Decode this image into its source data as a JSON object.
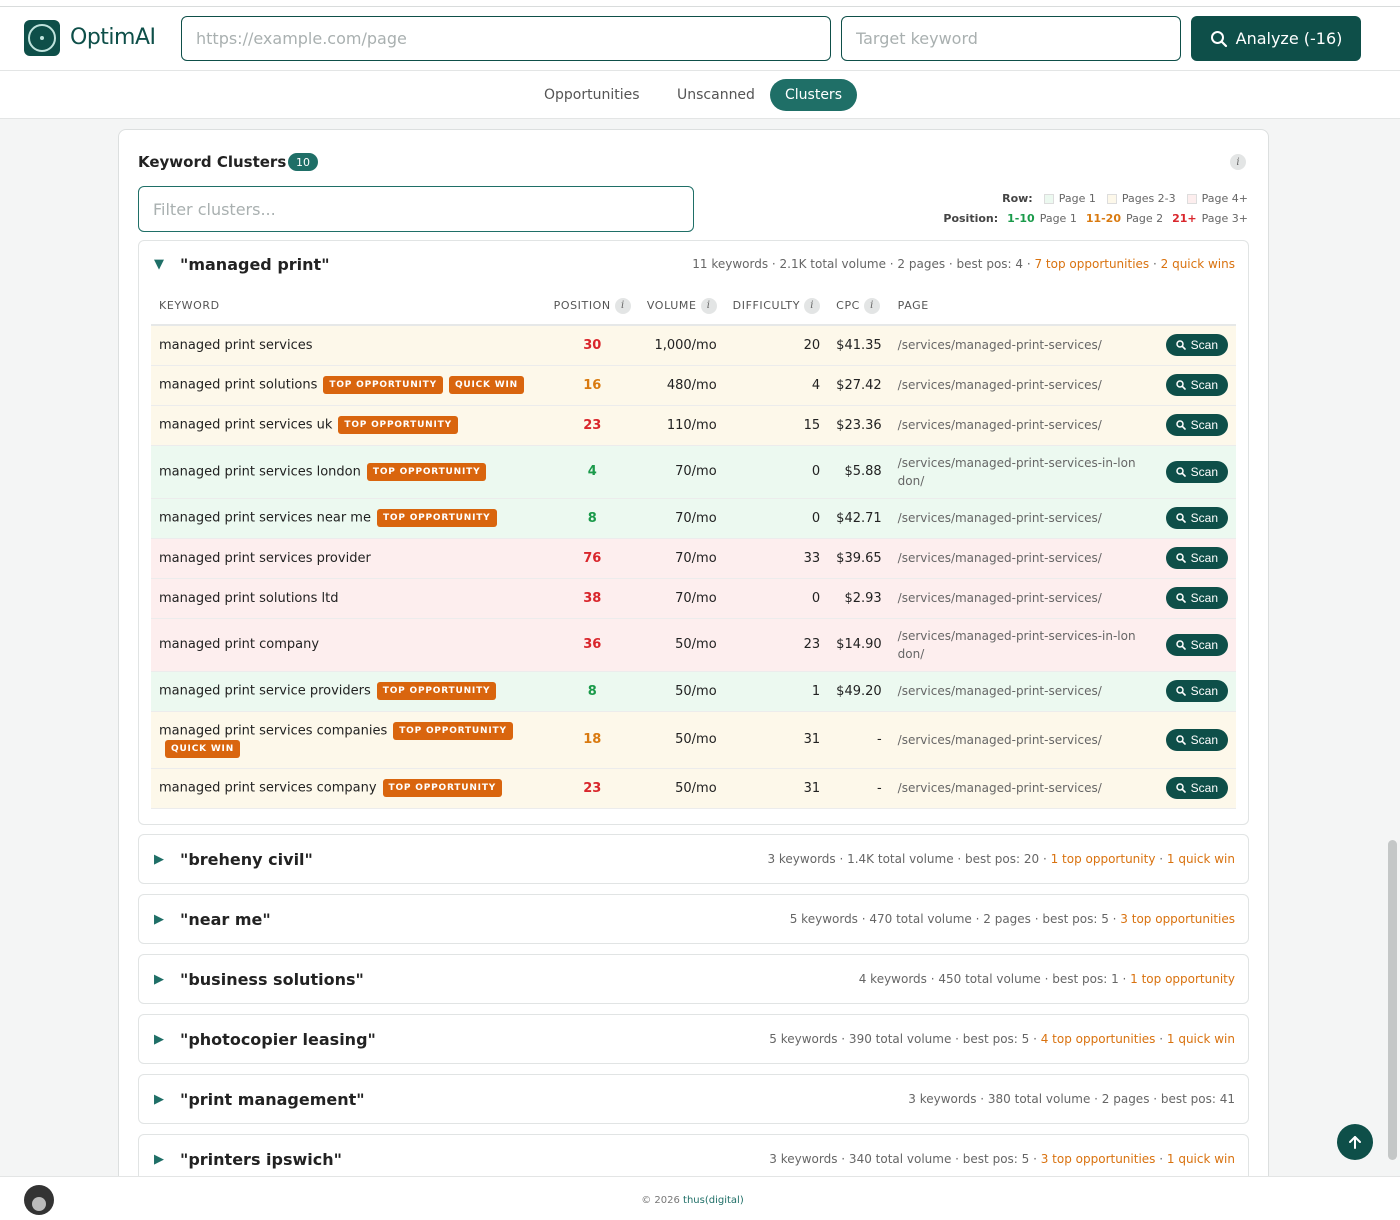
{
  "app": {
    "brand": "OptimAI"
  },
  "header": {
    "url_placeholder": "https://example.com/page",
    "keyword_placeholder": "Target keyword",
    "analyze_label": "Analyze (-16)"
  },
  "tabs": [
    {
      "label": "Opportunities",
      "active": false
    },
    {
      "label": "Unscanned",
      "active": false
    },
    {
      "label": "Clusters",
      "active": true
    }
  ],
  "card": {
    "title": "Keyword Clusters",
    "count": "10",
    "filter_placeholder": "Filter clusters...",
    "legend": {
      "row_label": "Row:",
      "row_items": [
        "Page 1",
        "Pages 2-3",
        "Page 4+"
      ],
      "row_colors": [
        "#ecf9f0",
        "#fdf8ea",
        "#fdeeee"
      ],
      "position_label": "Position:",
      "pos_items": [
        {
          "range": "1-10",
          "page": "Page 1"
        },
        {
          "range": "11-20",
          "page": "Page 2"
        },
        {
          "range": "21+",
          "page": "Page 3+"
        }
      ]
    }
  },
  "open_cluster": {
    "name": "\"managed print\"",
    "meta": "11 keywords · 2.1K total volume · 2 pages · best pos: 4 · ",
    "meta_hl1": "7 top opportunities",
    "meta_sep": " · ",
    "meta_hl2": "2 quick wins",
    "columns": [
      "KEYWORD",
      "POSITION",
      "VOLUME",
      "DIFFICULTY",
      "CPC",
      "PAGE"
    ],
    "scan_label": "Scan",
    "tag_top": "TOP OPPORTUNITY",
    "tag_quick": "QUICK WIN",
    "rows": [
      {
        "keyword": "managed print services",
        "position": "30",
        "volume": "1,000/mo",
        "difficulty": "20",
        "cpc": "$41.35",
        "page": "/services/managed-print-services/"
      },
      {
        "keyword": "managed print solutions",
        "position": "16",
        "volume": "480/mo",
        "difficulty": "4",
        "cpc": "$27.42",
        "page": "/services/managed-print-services/"
      },
      {
        "keyword": "managed print services uk",
        "position": "23",
        "volume": "110/mo",
        "difficulty": "15",
        "cpc": "$23.36",
        "page": "/services/managed-print-services/"
      },
      {
        "keyword": "managed print services london",
        "position": "4",
        "volume": "70/mo",
        "difficulty": "0",
        "cpc": "$5.88",
        "page": "/services/managed-print-services-in-london/"
      },
      {
        "keyword": "managed print services near me",
        "position": "8",
        "volume": "70/mo",
        "difficulty": "0",
        "cpc": "$42.71",
        "page": "/services/managed-print-services/"
      },
      {
        "keyword": "managed print services provider",
        "position": "76",
        "volume": "70/mo",
        "difficulty": "33",
        "cpc": "$39.65",
        "page": "/services/managed-print-services/"
      },
      {
        "keyword": "managed print solutions ltd",
        "position": "38",
        "volume": "70/mo",
        "difficulty": "0",
        "cpc": "$2.93",
        "page": "/services/managed-print-services/"
      },
      {
        "keyword": "managed print company",
        "position": "36",
        "volume": "50/mo",
        "difficulty": "23",
        "cpc": "$14.90",
        "page": "/services/managed-print-services-in-london/"
      },
      {
        "keyword": "managed print service providers",
        "position": "8",
        "volume": "50/mo",
        "difficulty": "1",
        "cpc": "$49.20",
        "page": "/services/managed-print-services/"
      },
      {
        "keyword": "managed print services companies",
        "position": "18",
        "volume": "50/mo",
        "difficulty": "31",
        "cpc": "-",
        "page": "/services/managed-print-services/"
      },
      {
        "keyword": "managed print services company",
        "position": "23",
        "volume": "50/mo",
        "difficulty": "31",
        "cpc": "-",
        "page": "/services/managed-print-services/"
      }
    ]
  },
  "clusters": [
    {
      "name": "\"breheny civil\"",
      "meta": "3 keywords · 1.4K total volume · best pos: 20 · ",
      "hl1": "1 top opportunity",
      "sep": " · ",
      "hl2": "1 quick win"
    },
    {
      "name": "\"near me\"",
      "meta": "5 keywords · 470 total volume · 2 pages · best pos: 5 · ",
      "hl1": "3 top opportunities",
      "sep": "",
      "hl2": ""
    },
    {
      "name": "\"business solutions\"",
      "meta": "4 keywords · 450 total volume · best pos: 1 · ",
      "hl1": "1 top opportunity",
      "sep": "",
      "hl2": ""
    },
    {
      "name": "\"photocopier leasing\"",
      "meta": "5 keywords · 390 total volume · best pos: 5 · ",
      "hl1": "4 top opportunities",
      "sep": " · ",
      "hl2": "1 quick win"
    },
    {
      "name": "\"print management\"",
      "meta": "3 keywords · 380 total volume · 2 pages · best pos: 41",
      "hl1": "",
      "sep": "",
      "hl2": ""
    },
    {
      "name": "\"printers ipswich\"",
      "meta": "3 keywords · 340 total volume · best pos: 5 · ",
      "hl1": "3 top opportunities",
      "sep": " · ",
      "hl2": "1 quick win"
    }
  ],
  "footer": {
    "copyright": "© 2026 ",
    "link": "thus(digital)"
  },
  "colors": {
    "brand": "#0e4f49",
    "accent": "#1f6f67",
    "tag": "#d9650e",
    "green": "#1a9a4a",
    "orange": "#d97a10",
    "red": "#d9262c"
  }
}
